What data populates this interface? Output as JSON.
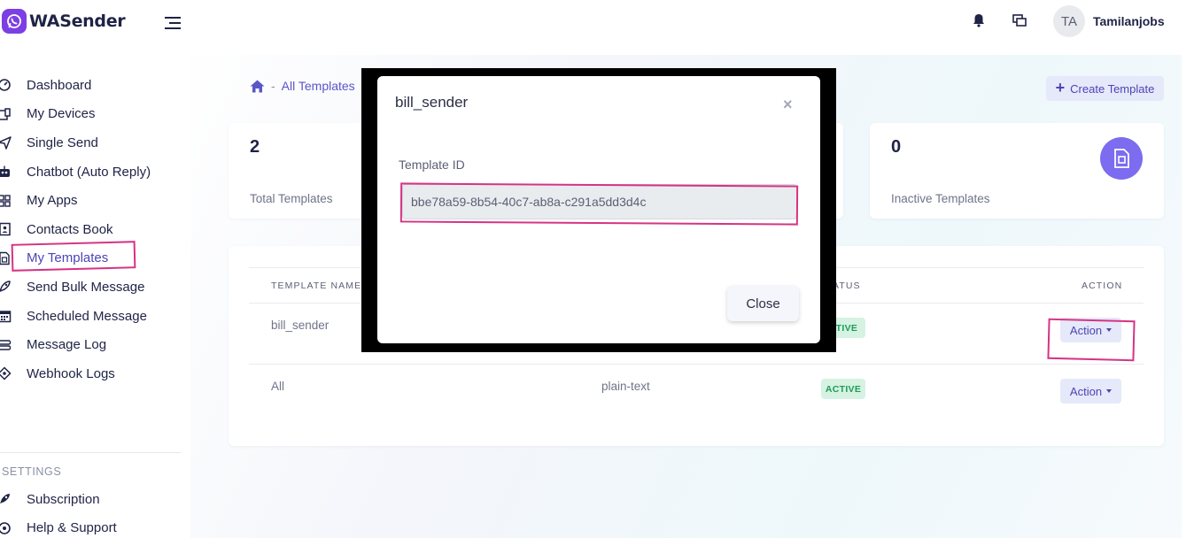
{
  "app": {
    "name": "WASender"
  },
  "header": {
    "avatar_initials": "TA",
    "username": "Tamilanjobs"
  },
  "sidebar": {
    "items": [
      {
        "label": "Dashboard",
        "icon": "dashboard-icon"
      },
      {
        "label": "My Devices",
        "icon": "devices-icon"
      },
      {
        "label": "Single Send",
        "icon": "paper-plane-icon"
      },
      {
        "label": "Chatbot (Auto Reply)",
        "icon": "robot-icon"
      },
      {
        "label": "My Apps",
        "icon": "apps-icon"
      },
      {
        "label": "Contacts Book",
        "icon": "contacts-book-icon"
      },
      {
        "label": "My Templates",
        "icon": "template-icon",
        "active": true
      },
      {
        "label": "Send Bulk Message",
        "icon": "rocket-icon"
      },
      {
        "label": "Scheduled Message",
        "icon": "calendar-icon"
      },
      {
        "label": "Message Log",
        "icon": "message-log-icon"
      },
      {
        "label": "Webhook Logs",
        "icon": "webhook-icon"
      }
    ],
    "settings_heading": "SETTINGS",
    "settings_items": [
      {
        "label": "Subscription",
        "icon": "rocket-icon"
      },
      {
        "label": "Help & Support",
        "icon": "help-icon"
      }
    ]
  },
  "breadcrumb": {
    "current": "All Templates",
    "separator": "-"
  },
  "create_button": "Create Template",
  "stats": {
    "total": {
      "value": "2",
      "label": "Total Templates"
    },
    "inactive": {
      "value": "0",
      "label": "Inactive Templates"
    }
  },
  "table": {
    "headers": {
      "name": "TEMPLATE NAME",
      "status": "ATUS",
      "action": "ACTION"
    },
    "rows": [
      {
        "name": "bill_sender",
        "type": "",
        "status": "CTIVE",
        "action": "Action"
      },
      {
        "name": "All",
        "type": "plain-text",
        "status": "ACTIVE",
        "action": "Action"
      }
    ]
  },
  "modal": {
    "title": "bill_sender",
    "close_x": "×",
    "field_label": "Template ID",
    "field_value": "bbe78a59-8b54-40c7-ab8a-c291a5dd3d4c",
    "close_button": "Close"
  },
  "colors": {
    "accent": "#4d44b5",
    "brand": "#7b3fe4",
    "annotation": "#d63384",
    "badge_bg": "#d5f2e3",
    "badge_text": "#1f9d55"
  }
}
